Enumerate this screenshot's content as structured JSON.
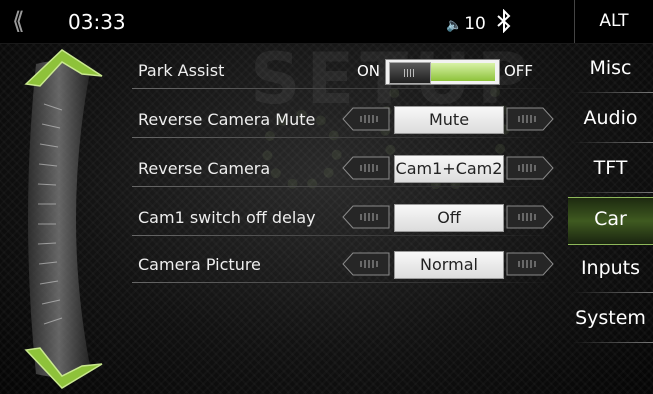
{
  "statusbar": {
    "back_icon": "double-chevron-left-icon",
    "time": "03:33",
    "volume_icon": "speaker-icon",
    "volume_level": "10",
    "bluetooth_icon": "bluetooth-icon",
    "alt_label": "ALT"
  },
  "watermark": "SETUP",
  "settings": {
    "park_assist": {
      "label": "Park Assist",
      "on_label": "ON",
      "off_label": "OFF",
      "state": "ON"
    },
    "rows": [
      {
        "label": "Reverse Camera Mute",
        "value": "Mute"
      },
      {
        "label": "Reverse Camera",
        "value": "Cam1+Cam2"
      },
      {
        "label": "Cam1 switch off delay",
        "value": "Off"
      },
      {
        "label": "Camera Picture",
        "value": "Normal"
      }
    ],
    "arrow_left_icon": "arrow-left-icon",
    "arrow_right_icon": "arrow-right-icon"
  },
  "sidebar": {
    "tabs": [
      {
        "label": "Misc"
      },
      {
        "label": "Audio"
      },
      {
        "label": "TFT"
      },
      {
        "label": "Car"
      },
      {
        "label": "Inputs"
      },
      {
        "label": "System"
      }
    ],
    "active_tab": "Car"
  },
  "scroll": {
    "up_icon": "scroll-up-icon",
    "down_icon": "scroll-down-icon"
  },
  "colors": {
    "accent": "#8ec23a",
    "active_tab": "#3f5a20",
    "background": "#121212"
  }
}
